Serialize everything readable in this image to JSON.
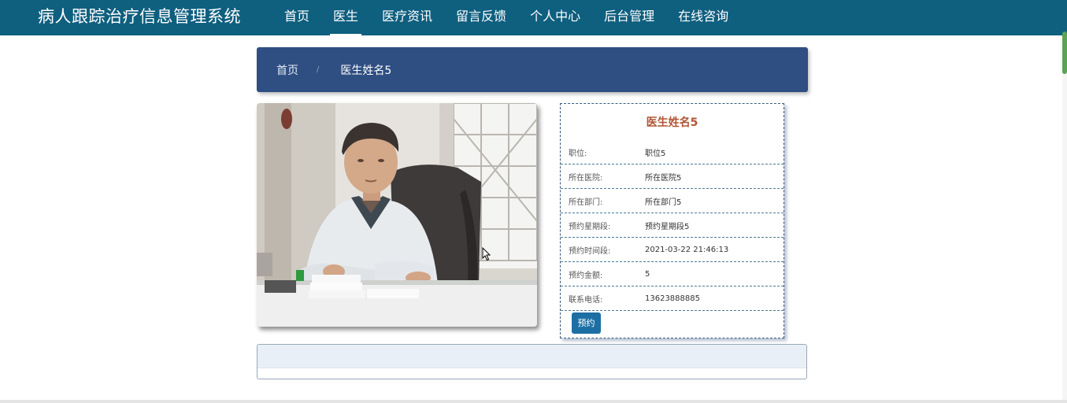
{
  "app": {
    "title": "病人跟踪治疗信息管理系统"
  },
  "nav": {
    "items": [
      {
        "label": "首页"
      },
      {
        "label": "医生",
        "active": true
      },
      {
        "label": "医疗资讯"
      },
      {
        "label": "留言反馈"
      },
      {
        "label": "个人中心"
      },
      {
        "label": "后台管理"
      },
      {
        "label": "在线咨询"
      }
    ]
  },
  "breadcrumb": {
    "home": "首页",
    "separator": "/",
    "current": "医生姓名5"
  },
  "doctor": {
    "name": "医生姓名5",
    "fields": [
      {
        "label": "职位:",
        "value": "职位5"
      },
      {
        "label": "所在医院:",
        "value": "所在医院5"
      },
      {
        "label": "所在部门:",
        "value": "所在部门5"
      },
      {
        "label": "预约星期段:",
        "value": "预约星期段5"
      },
      {
        "label": "预约时间段:",
        "value": "2021-03-22 21:46:13"
      },
      {
        "label": "预约金额:",
        "value": "5"
      },
      {
        "label": "联系电话:",
        "value": "13623888885"
      }
    ],
    "book_button": "预约"
  },
  "colors": {
    "topbar": "#0f5f7f",
    "breadcrumb": "#2f4f82",
    "doctor_name": "#b25535",
    "button": "#1d6fa3"
  }
}
